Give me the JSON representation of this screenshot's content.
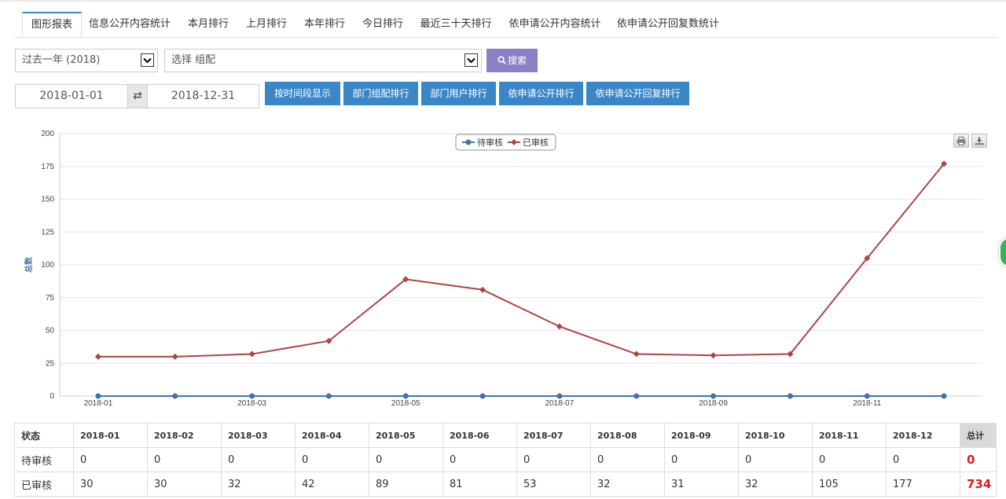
{
  "tabs": [
    "图形报表",
    "信息公开内容统计",
    "本月排行",
    "上月排行",
    "本年排行",
    "今日排行",
    "最近三十天排行",
    "依申请公开内容统计",
    "依申请公开回复数统计"
  ],
  "filters": {
    "period_value": "过去一年 (2018)",
    "group_value": "选择 组配",
    "search_label": "搜索",
    "start_date": "2018-01-01",
    "swap_glyph": "⇄",
    "end_date": "2018-12-31"
  },
  "actions": [
    "按时间段显示",
    "部门组配排行",
    "部门用户排行",
    "依申请公开排行",
    "依申请公开回复排行"
  ],
  "chart_data": {
    "type": "line",
    "x": [
      "2018-01",
      "2018-02",
      "2018-03",
      "2018-04",
      "2018-05",
      "2018-06",
      "2018-07",
      "2018-08",
      "2018-09",
      "2018-10",
      "2018-11",
      "2018-12"
    ],
    "x_tick_labels": [
      "2018-01",
      "2018-03",
      "2018-05",
      "2018-07",
      "2018-09",
      "2018-11"
    ],
    "ylabel": "总数",
    "ylim": [
      0,
      200
    ],
    "y_ticks": [
      0,
      25,
      50,
      75,
      100,
      125,
      150,
      175,
      200
    ],
    "legend_position": "top-center",
    "grid": true,
    "series": [
      {
        "name": "待审核",
        "color": "#4572a7",
        "values": [
          0,
          0,
          0,
          0,
          0,
          0,
          0,
          0,
          0,
          0,
          0,
          0
        ]
      },
      {
        "name": "已审核",
        "color": "#aa4643",
        "values": [
          30,
          30,
          32,
          42,
          89,
          81,
          53,
          32,
          31,
          32,
          105,
          177
        ]
      }
    ]
  },
  "table": {
    "status_header": "状态",
    "total_header": "总计",
    "months": [
      "2018-01",
      "2018-02",
      "2018-03",
      "2018-04",
      "2018-05",
      "2018-06",
      "2018-07",
      "2018-08",
      "2018-09",
      "2018-10",
      "2018-11",
      "2018-12"
    ],
    "rows": [
      {
        "label": "待审核",
        "values": [
          "0",
          "0",
          "0",
          "0",
          "0",
          "0",
          "0",
          "0",
          "0",
          "0",
          "0",
          "0"
        ],
        "total": "0"
      },
      {
        "label": "已审核",
        "values": [
          "30",
          "30",
          "32",
          "42",
          "89",
          "81",
          "53",
          "32",
          "31",
          "32",
          "105",
          "177"
        ],
        "total": "734"
      }
    ]
  }
}
